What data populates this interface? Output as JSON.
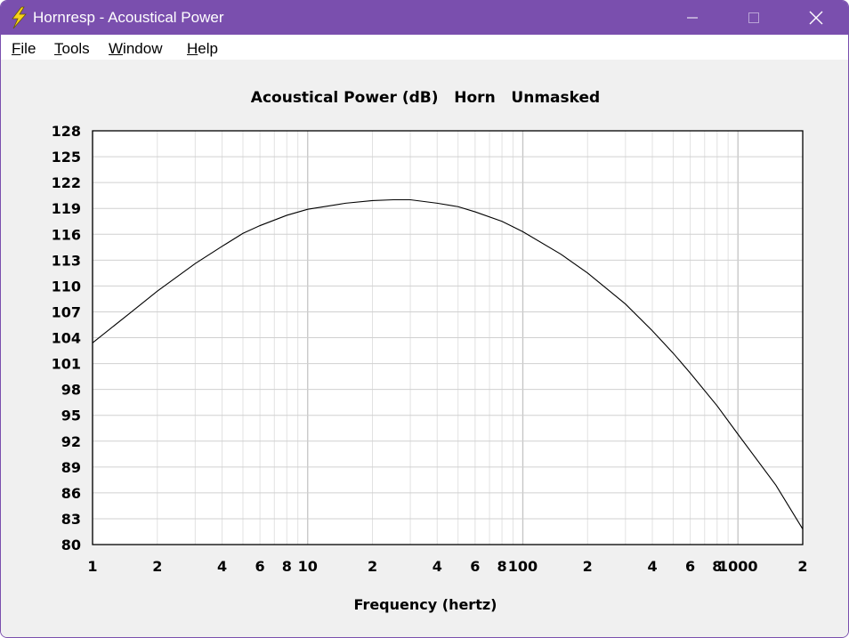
{
  "window": {
    "title": "Hornresp - Acoustical Power",
    "icon": "lightning-bolt-icon",
    "title_bar_color": "#7a4fae",
    "controls": [
      "minimize-icon",
      "maximize-icon",
      "close-icon"
    ]
  },
  "menu": {
    "items": [
      {
        "accel": "F",
        "rest": "ile"
      },
      {
        "accel": "T",
        "rest": "ools"
      },
      {
        "accel": "W",
        "rest": "indow"
      },
      {
        "accel": "H",
        "rest": "elp"
      }
    ]
  },
  "chart_data": {
    "type": "line",
    "title": "Acoustical Power (dB)   Horn   Unmasked",
    "xlabel": "Frequency (hertz)",
    "ylabel": "",
    "x_scale": "log",
    "xlim": [
      1,
      2000
    ],
    "ylim": [
      80,
      128
    ],
    "x_tick_labels": [
      {
        "value": 1,
        "label": "1"
      },
      {
        "value": 2,
        "label": "2"
      },
      {
        "value": 4,
        "label": "4"
      },
      {
        "value": 6,
        "label": "6"
      },
      {
        "value": 8,
        "label": "8"
      },
      {
        "value": 10,
        "label": "10"
      },
      {
        "value": 20,
        "label": "2"
      },
      {
        "value": 40,
        "label": "4"
      },
      {
        "value": 60,
        "label": "6"
      },
      {
        "value": 80,
        "label": "8"
      },
      {
        "value": 100,
        "label": "100"
      },
      {
        "value": 200,
        "label": "2"
      },
      {
        "value": 400,
        "label": "4"
      },
      {
        "value": 600,
        "label": "6"
      },
      {
        "value": 800,
        "label": "8"
      },
      {
        "value": 1000,
        "label": "1000"
      },
      {
        "value": 2000,
        "label": "2"
      }
    ],
    "y_ticks": [
      128,
      125,
      122,
      119,
      116,
      113,
      110,
      107,
      104,
      101,
      98,
      95,
      92,
      89,
      86,
      83,
      80
    ],
    "grid": true,
    "line_color": "#000000",
    "series": [
      {
        "x": [
          1,
          1.5,
          2,
          3,
          4,
          5,
          6,
          8,
          10,
          15,
          20,
          25,
          30,
          40,
          50,
          60,
          80,
          100,
          150,
          200,
          300,
          400,
          500,
          600,
          800,
          1000,
          1500,
          2000
        ],
        "y": [
          103.4,
          106.9,
          109.4,
          112.6,
          114.6,
          116.1,
          117.0,
          118.2,
          118.9,
          119.6,
          119.9,
          120.0,
          120.0,
          119.6,
          119.2,
          118.6,
          117.5,
          116.3,
          113.7,
          111.5,
          107.9,
          104.8,
          102.2,
          99.9,
          96.1,
          92.8,
          86.9,
          81.8
        ]
      }
    ]
  }
}
